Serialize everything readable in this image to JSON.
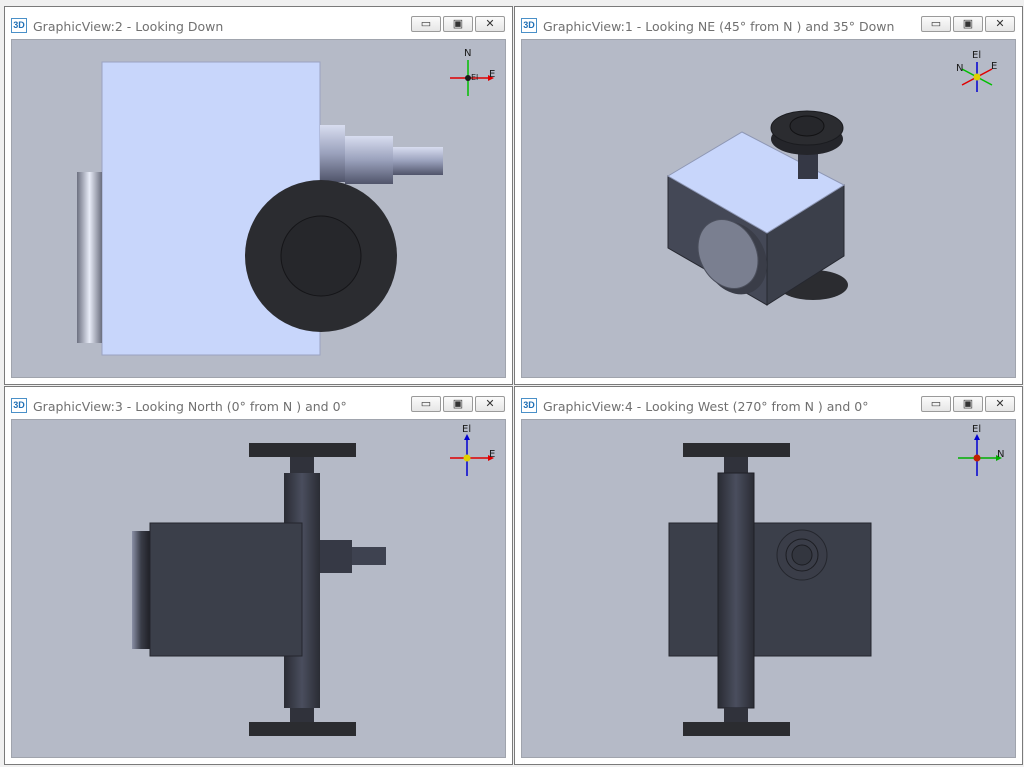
{
  "windows": [
    {
      "id": "gv2",
      "title": "GraphicView:2 - Looking Down",
      "icon_label": "3D",
      "controls": {
        "minimize": "▭",
        "restore": "▣",
        "close": "✕"
      },
      "axis_triad": {
        "top": "N",
        "right": "E",
        "center": "El"
      }
    },
    {
      "id": "gv1",
      "title": "GraphicView:1 - Looking NE (45° from N ) and 35° Down",
      "icon_label": "3D",
      "controls": {
        "minimize": "▭",
        "restore": "▣",
        "close": "✕"
      },
      "axis_triad": {
        "top": "El",
        "left": "N",
        "right": "E"
      }
    },
    {
      "id": "gv3",
      "title": "GraphicView:3 - Looking North (0° from N ) and 0°",
      "icon_label": "3D",
      "controls": {
        "minimize": "▭",
        "restore": "▣",
        "close": "✕"
      },
      "axis_triad": {
        "top": "El",
        "right": "E"
      }
    },
    {
      "id": "gv4",
      "title": "GraphicView:4 - Looking West (270° from N ) and 0°",
      "icon_label": "3D",
      "controls": {
        "minimize": "▭",
        "restore": "▣",
        "close": "✕"
      },
      "axis_triad": {
        "top": "El",
        "right": "N"
      }
    }
  ],
  "colors": {
    "viewport_bg": "#b5bac7",
    "body_light": "#c8d6fb",
    "body_dark": "#3b3f4a",
    "flange_dark": "#2b2c30"
  }
}
